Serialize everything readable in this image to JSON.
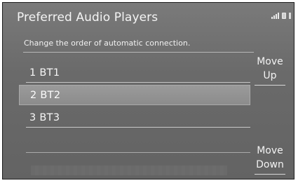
{
  "header": {
    "title": "Preferred Audio Players"
  },
  "status_icons": [
    "signal-icon",
    "phone-battery-icon",
    "bluetooth-icon"
  ],
  "subtitle": "Change the order of automatic connection.",
  "list": {
    "items": [
      {
        "label": "1  BT1",
        "selected": false
      },
      {
        "label": "2  BT2",
        "selected": true
      },
      {
        "label": "3  BT3",
        "selected": false
      },
      {
        "label": "",
        "selected": false
      }
    ]
  },
  "buttons": {
    "move_up": {
      "line1": "Move",
      "line2": "Up"
    },
    "move_down": {
      "line1": "Move",
      "line2": "Down"
    }
  },
  "colors": {
    "background": "#6d6d6d",
    "selected_row": "#939393",
    "text": "#f2f2f2"
  }
}
